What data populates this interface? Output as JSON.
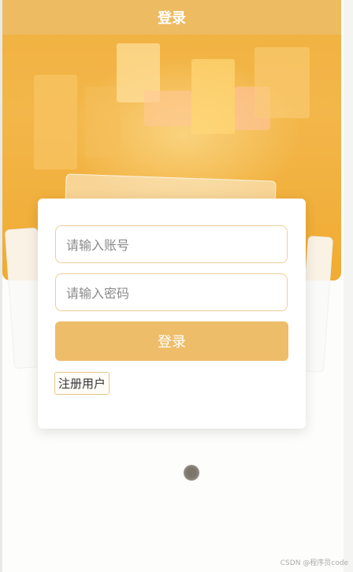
{
  "header": {
    "title": "登录"
  },
  "login_form": {
    "account_placeholder": "请输入账号",
    "password_placeholder": "请输入密码",
    "login_button_label": "登录",
    "register_button_label": "注册用户"
  },
  "watermark": {
    "text": "CSDN @程序员code"
  },
  "colors": {
    "primary": "#eebd69",
    "hero_background": "#f0b13e",
    "input_border": "#efcf96"
  }
}
